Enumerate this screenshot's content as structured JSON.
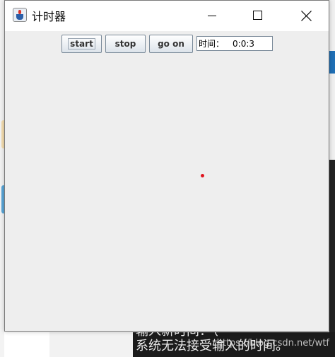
{
  "window": {
    "title": "计时器"
  },
  "toolbar": {
    "start_label": "start",
    "stop_label": "stop",
    "goon_label": "go on"
  },
  "timer": {
    "label": "时间：",
    "value": "0:0:3"
  },
  "background": {
    "terminal_line1": "输入新时间：（",
    "terminal_line2": "系统无法接受输入的时间。",
    "watermark": "https://blog.csdn.net/wtf"
  },
  "colors": {
    "dot": "#e0141e",
    "window_bg": "#eeeeee"
  }
}
